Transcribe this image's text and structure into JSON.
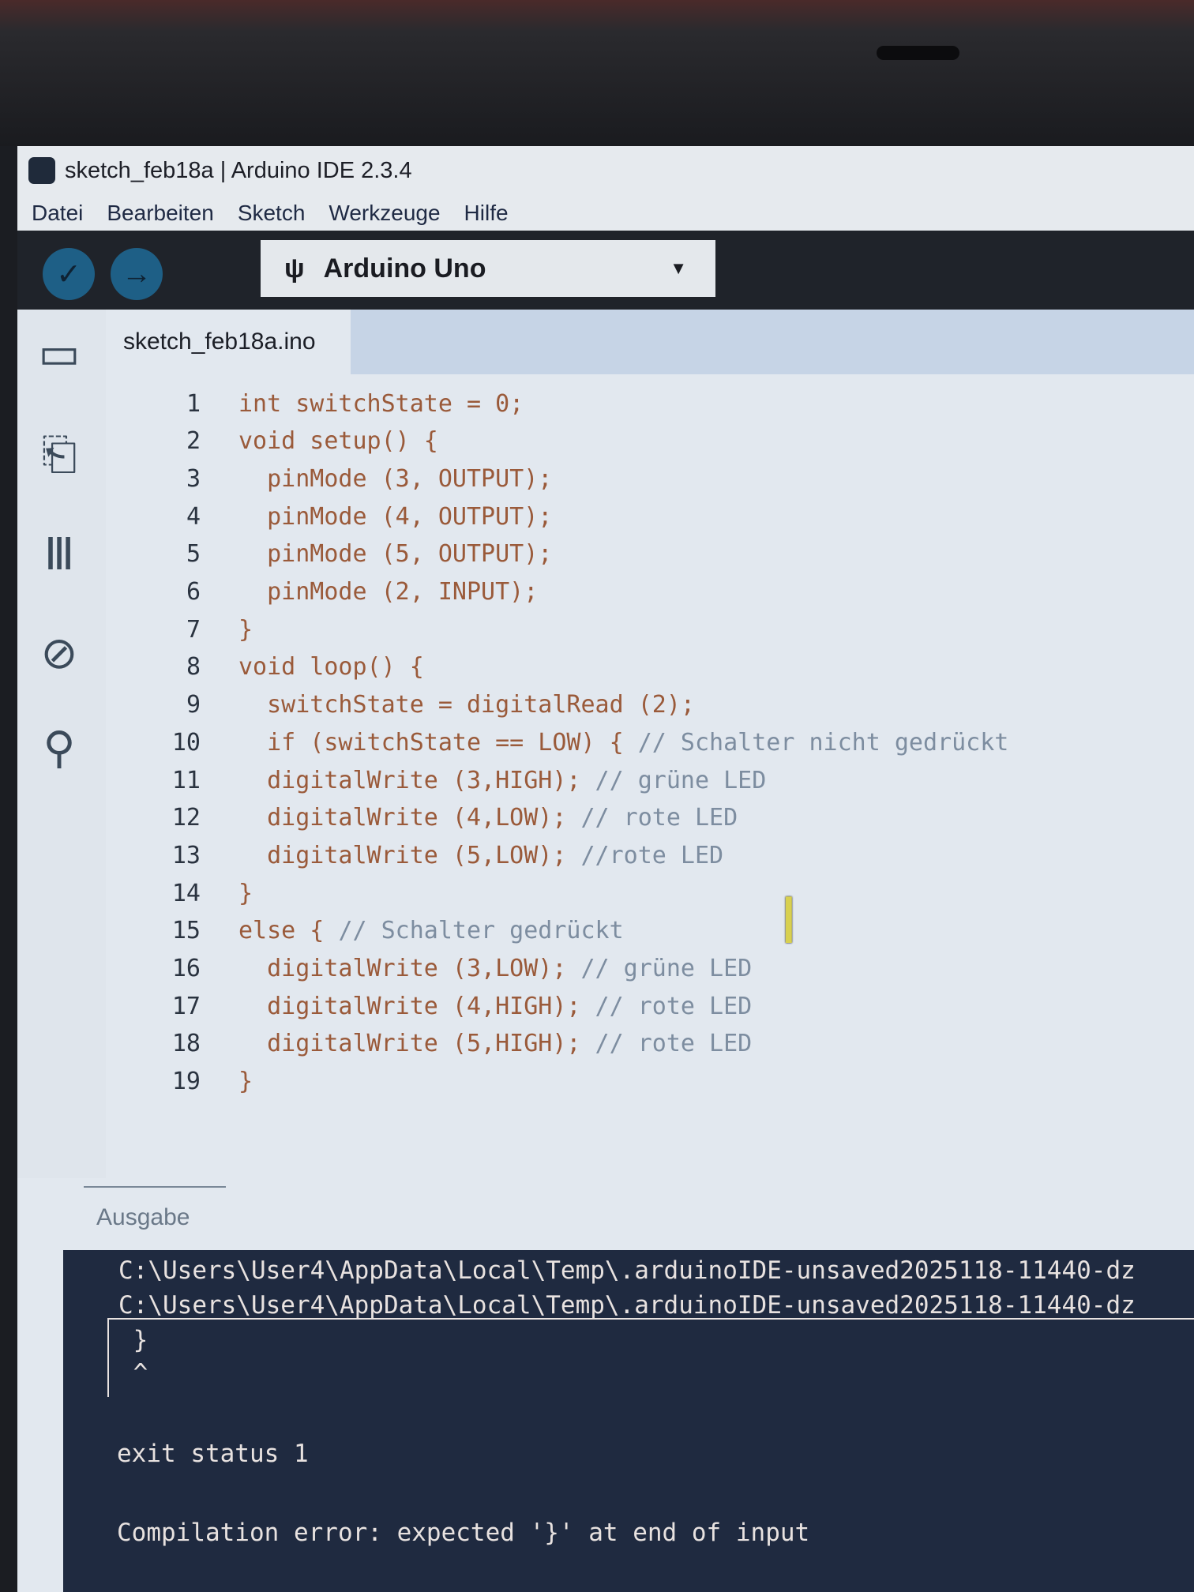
{
  "window": {
    "title": "sketch_feb18a | Arduino IDE 2.3.4"
  },
  "menu": [
    "Datei",
    "Bearbeiten",
    "Sketch",
    "Werkzeuge",
    "Hilfe"
  ],
  "toolbar": {
    "verify_icon": "✓",
    "upload_icon": "→",
    "board": "Arduino Uno",
    "usb_icon": "ψ",
    "caret": "▼"
  },
  "sidebar": {
    "icons": [
      "folder-icon",
      "board-icon",
      "library-icon",
      "debug-icon",
      "search-icon"
    ],
    "glyphs": [
      "▭",
      "⎗",
      "Ⅲ",
      "⊘",
      "⚲"
    ]
  },
  "tab": {
    "label": "sketch_feb18a.ino"
  },
  "code": [
    {
      "n": "1",
      "indent": "",
      "code": "int switchState = 0;",
      "comment": ""
    },
    {
      "n": "2",
      "indent": "",
      "code": "void setup() {",
      "comment": ""
    },
    {
      "n": "3",
      "indent": "  ",
      "code": "pinMode (3, OUTPUT);",
      "comment": ""
    },
    {
      "n": "4",
      "indent": "  ",
      "code": "pinMode (4, OUTPUT);",
      "comment": ""
    },
    {
      "n": "5",
      "indent": "  ",
      "code": "pinMode (5, OUTPUT);",
      "comment": ""
    },
    {
      "n": "6",
      "indent": "  ",
      "code": "pinMode (2, INPUT);",
      "comment": ""
    },
    {
      "n": "7",
      "indent": "",
      "code": "}",
      "comment": ""
    },
    {
      "n": "8",
      "indent": "",
      "code": "void loop() {",
      "comment": ""
    },
    {
      "n": "9",
      "indent": "  ",
      "code": "switchState = digitalRead (2);",
      "comment": ""
    },
    {
      "n": "10",
      "indent": "  ",
      "code": "if (switchState == LOW) { ",
      "comment": "// Schalter nicht gedrückt"
    },
    {
      "n": "11",
      "indent": "  ",
      "code": "digitalWrite (3,HIGH); ",
      "comment": "// grüne LED"
    },
    {
      "n": "12",
      "indent": "  ",
      "code": "digitalWrite (4,LOW); ",
      "comment": "// rote LED"
    },
    {
      "n": "13",
      "indent": "  ",
      "code": "digitalWrite (5,LOW); ",
      "comment": "//rote LED"
    },
    {
      "n": "14",
      "indent": "",
      "code": "}",
      "comment": ""
    },
    {
      "n": "15",
      "indent": "",
      "code": "else { ",
      "comment": "// Schalter gedrückt"
    },
    {
      "n": "16",
      "indent": "  ",
      "code": "digitalWrite (3,LOW); ",
      "comment": "// grüne LED"
    },
    {
      "n": "17",
      "indent": "  ",
      "code": "digitalWrite (4,HIGH); ",
      "comment": "// rote LED"
    },
    {
      "n": "18",
      "indent": "  ",
      "code": "digitalWrite (5,HIGH); ",
      "comment": "// rote LED"
    },
    {
      "n": "19",
      "indent": "",
      "code": "}",
      "comment": ""
    }
  ],
  "output": {
    "label": "Ausgabe",
    "lines": [
      "C:\\Users\\User4\\AppData\\Local\\Temp\\.arduinoIDE-unsaved2025118-11440-dz",
      "C:\\Users\\User4\\AppData\\Local\\Temp\\.arduinoIDE-unsaved2025118-11440-dz",
      " }",
      " ^",
      "exit status 1",
      "Compilation error: expected '}' at end of input"
    ]
  }
}
